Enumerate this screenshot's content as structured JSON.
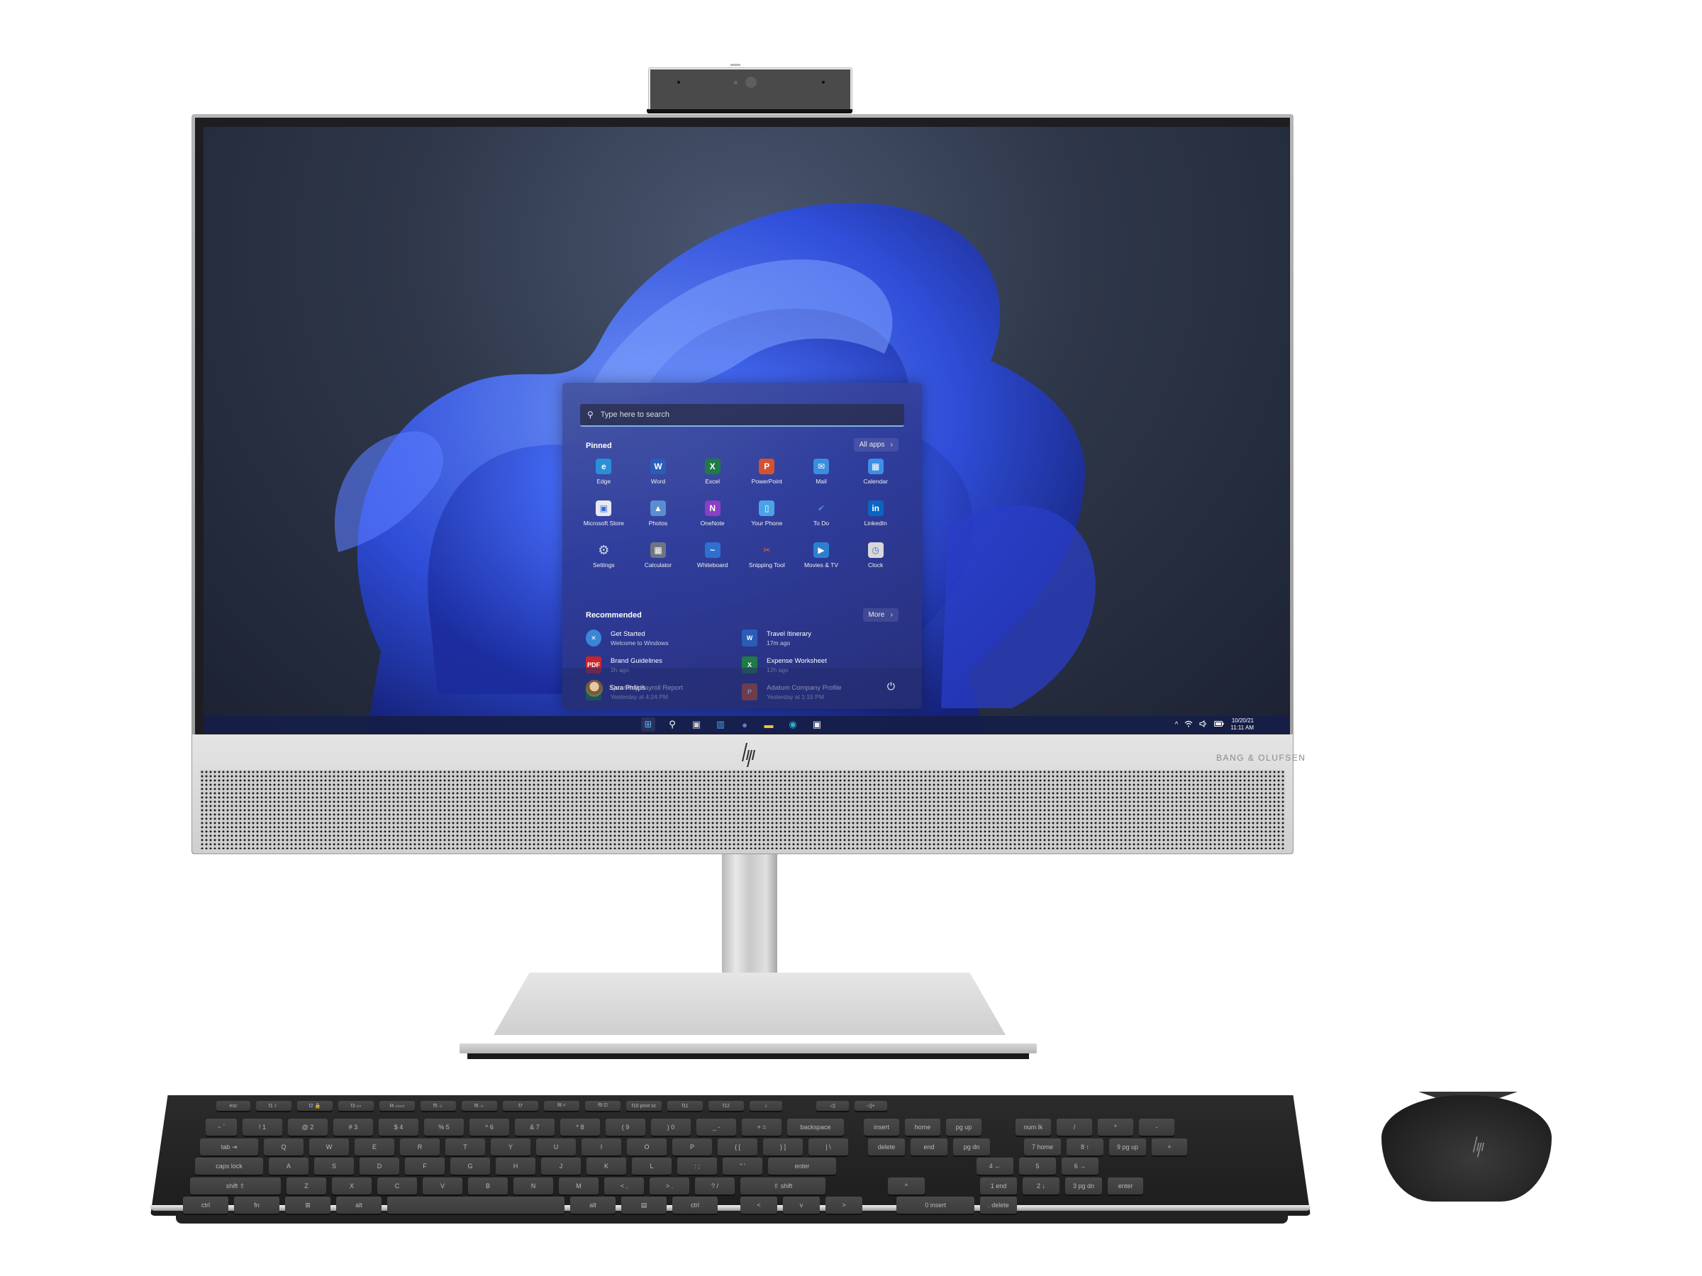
{
  "device": {
    "monitor_brand_text": "BANG & OLUFSEN",
    "logo": "hp-logo"
  },
  "start_menu": {
    "search_placeholder": "Type here to search",
    "pinned_title": "Pinned",
    "all_apps_label": "All apps",
    "pinned_apps": [
      {
        "label": "Edge",
        "icon": "edge-icon",
        "color": "#2b8fd8",
        "glyph": "e"
      },
      {
        "label": "Word",
        "icon": "word-icon",
        "color": "#2b5cb8",
        "glyph": "W"
      },
      {
        "label": "Excel",
        "icon": "excel-icon",
        "color": "#1f7a45",
        "glyph": "X"
      },
      {
        "label": "PowerPoint",
        "icon": "powerpoint-icon",
        "color": "#d35230",
        "glyph": "P"
      },
      {
        "label": "Mail",
        "icon": "mail-icon",
        "color": "#3a8ee0",
        "glyph": "✉"
      },
      {
        "label": "Calendar",
        "icon": "calendar-icon",
        "color": "#3d8ee6",
        "glyph": "▦"
      },
      {
        "label": "Microsoft Store",
        "icon": "store-icon",
        "color": "#e8e8f0",
        "glyph": "▣"
      },
      {
        "label": "Photos",
        "icon": "photos-icon",
        "color": "#5a8ed0",
        "glyph": "▲"
      },
      {
        "label": "OneNote",
        "icon": "onenote-icon",
        "color": "#8b3fc4",
        "glyph": "N"
      },
      {
        "label": "Your Phone",
        "icon": "phone-icon",
        "color": "#4aa3e8",
        "glyph": "▯"
      },
      {
        "label": "To Do",
        "icon": "todo-icon",
        "color": "transparent",
        "glyph": "✔"
      },
      {
        "label": "LinkedIn",
        "icon": "linkedin-icon",
        "color": "#0a66c2",
        "glyph": "in"
      },
      {
        "label": "Settings",
        "icon": "settings-icon",
        "color": "transparent",
        "glyph": "⚙"
      },
      {
        "label": "Calculator",
        "icon": "calculator-icon",
        "color": "#6f7580",
        "glyph": "▦"
      },
      {
        "label": "Whiteboard",
        "icon": "whiteboard-icon",
        "color": "#2f6fd0",
        "glyph": "~"
      },
      {
        "label": "Snipping Tool",
        "icon": "snipping-tool-icon",
        "color": "transparent",
        "glyph": "✂"
      },
      {
        "label": "Movies & TV",
        "icon": "movies-icon",
        "color": "#2f7fd0",
        "glyph": "▶"
      },
      {
        "label": "Clock",
        "icon": "clock-icon",
        "color": "#d8d8d8",
        "glyph": "◷"
      }
    ],
    "recommended_title": "Recommended",
    "more_label": "More",
    "recommended": [
      {
        "title": "Get Started",
        "subtitle": "Welcome to Windows",
        "icon": "get-started-icon",
        "color": "#3a86d6",
        "glyph": "✕"
      },
      {
        "title": "Travel Itinerary",
        "subtitle": "17m ago",
        "icon": "word-doc-icon",
        "color": "#2b5cb8",
        "glyph": "W"
      },
      {
        "title": "Brand Guidelines",
        "subtitle": "2h ago",
        "icon": "pdf-icon",
        "color": "#c8242b",
        "glyph": "PDF"
      },
      {
        "title": "Expense Worksheet",
        "subtitle": "12h ago",
        "icon": "excel-doc-icon",
        "color": "#1f7a45",
        "glyph": "X"
      },
      {
        "title": "Quarterly Payroll Report",
        "subtitle": "Yesterday at 4:24 PM",
        "icon": "excel-doc-icon",
        "color": "#1f7a45",
        "glyph": "X"
      },
      {
        "title": "Adatum Company Profile",
        "subtitle": "Yesterday at 1:15 PM",
        "icon": "powerpoint-doc-icon",
        "color": "#c8502a",
        "glyph": "P"
      }
    ],
    "user_name": "Sara Philips",
    "power_glyph": "⏻"
  },
  "taskbar": {
    "icons": [
      {
        "name": "start-icon",
        "glyph": "⊞",
        "color": "#5fb3f5"
      },
      {
        "name": "search-icon",
        "glyph": "⚲",
        "color": "#ffffff"
      },
      {
        "name": "task-view-icon",
        "glyph": "▣",
        "color": "#d0d0d0"
      },
      {
        "name": "widgets-icon",
        "glyph": "▥",
        "color": "#4aa3e8"
      },
      {
        "name": "teams-chat-icon",
        "glyph": "●",
        "color": "#7b6fd6"
      },
      {
        "name": "file-explorer-icon",
        "glyph": "▬",
        "color": "#f2c23a"
      },
      {
        "name": "edge-icon",
        "glyph": "◉",
        "color": "#2bb3c9"
      },
      {
        "name": "store-icon",
        "glyph": "▣",
        "color": "#f0f0f0"
      }
    ],
    "tray": {
      "chevron": "^",
      "wifi": "wifi",
      "volume": "volume",
      "battery": "battery"
    },
    "date": "10/20/21",
    "time": "11:11 AM"
  },
  "keyboard": {
    "rows": [
      [
        "esc",
        "f1 ☾",
        "f2 🔒",
        "f3 ▭",
        "f4 ▭▭",
        "f5 ☼",
        "f6 ☼",
        "f7",
        "f8 ⌕",
        "f9 ⎚",
        "f10 print sc",
        "f11",
        "f12",
        "♪",
        "◁)",
        "◁)+"
      ],
      [
        "~ `",
        "! 1",
        "@ 2",
        "# 3",
        "$ 4",
        "% 5",
        "^ 6",
        "& 7",
        "* 8",
        "( 9",
        ") 0",
        "_ -",
        "+ =",
        "backspace",
        "insert",
        "home",
        "pg up",
        "num lk",
        "/",
        "*",
        "-"
      ],
      [
        "tab ⇥",
        "Q",
        "W",
        "E",
        "R",
        "T",
        "Y",
        "U",
        "I",
        "O",
        "P",
        "{ [",
        "} ]",
        "| \\",
        "delete",
        "end",
        "pg dn",
        "7 home",
        "8 ↑",
        "9 pg up",
        "+"
      ],
      [
        "caps lock",
        "A",
        "S",
        "D",
        "F",
        "G",
        "H",
        "J",
        "K",
        "L",
        ": ;",
        "\" '",
        "enter",
        "4 ←",
        "5",
        "6 →"
      ],
      [
        "shift ⇧",
        "Z",
        "X",
        "C",
        "V",
        "B",
        "N",
        "M",
        "< ,",
        "> .",
        "? /",
        "⇧ shift",
        "^",
        "1 end",
        "2 ↓",
        "3 pg dn",
        "enter"
      ],
      [
        "ctrl",
        "fn",
        "⊞",
        "alt",
        "",
        "alt",
        "▤",
        "ctrl",
        "<",
        "v",
        ">",
        "0 insert",
        ". delete"
      ]
    ]
  }
}
